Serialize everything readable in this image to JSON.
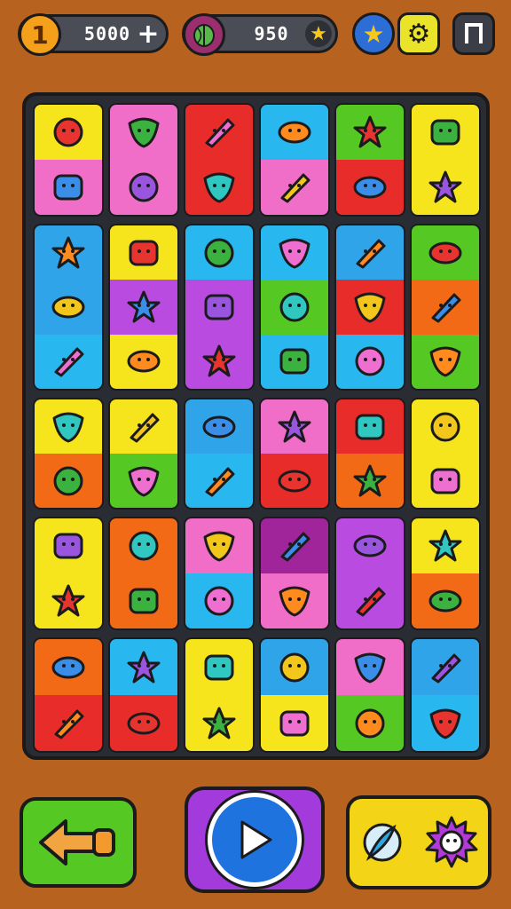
{
  "hud": {
    "coin_symbol": "1",
    "coins": "5000",
    "add_label": "+",
    "gems": "950",
    "star_badge": "★",
    "gear_glyph": "⚙"
  },
  "palette": {
    "yellow": "#f6e51c",
    "pink": "#f16ec8",
    "red": "#e82c2a",
    "cyan": "#29b7ef",
    "blue": "#2fa4e8",
    "green": "#55c824",
    "purple": "#b94be0",
    "orange": "#f26a15",
    "magenta": "#a0249a",
    "violet": "#8d5ae0"
  },
  "board": {
    "columns": [
      [
        {
          "colors": [
            "yellow",
            "pink"
          ],
          "icons": [
            "flashlight-icon",
            "leaf-icon"
          ]
        },
        {
          "colors": [
            "blue",
            "blue",
            "cyan"
          ],
          "icons": [
            "heart-icon",
            "virus-icon",
            "star-x-icon"
          ]
        },
        {
          "colors": [
            "yellow",
            "orange"
          ],
          "icons": [
            "bag-icon",
            "starfish-icon"
          ]
        },
        {
          "colors": [
            "yellow",
            "yellow"
          ],
          "icons": [
            "bat-icon",
            "bottle-icon"
          ]
        },
        {
          "colors": [
            "orange",
            "red"
          ],
          "icons": [
            "face-icon",
            "flashlight-icon"
          ]
        }
      ],
      [
        {
          "colors": [
            "pink",
            "pink"
          ],
          "icons": [
            "face-icon",
            "windmill-icon"
          ]
        },
        {
          "colors": [
            "yellow",
            "purple",
            "yellow"
          ],
          "icons": [
            "bread-icon",
            "ring-icon",
            "flower-icon"
          ]
        },
        {
          "colors": [
            "yellow",
            "green"
          ],
          "icons": [
            "rocket-icon",
            "bottle-icon"
          ]
        },
        {
          "colors": [
            "orange",
            "orange"
          ],
          "icons": [
            "bird-icon",
            "camera-icon"
          ]
        },
        {
          "colors": [
            "cyan",
            "red"
          ],
          "icons": [
            "bubble-icon",
            "palm-icon"
          ]
        }
      ],
      [
        {
          "colors": [
            "red",
            "red"
          ],
          "icons": [
            "cup-icon",
            "drink-icon"
          ]
        },
        {
          "colors": [
            "cyan",
            "purple",
            "purple"
          ],
          "icons": [
            "radio-icon",
            "bird-icon",
            "capsule-icon"
          ]
        },
        {
          "colors": [
            "blue",
            "cyan"
          ],
          "icons": [
            "calendar-icon",
            "domino-icon"
          ]
        },
        {
          "colors": [
            "pink",
            "cyan"
          ],
          "icons": [
            "grid-icon",
            "domino-icon"
          ]
        },
        {
          "colors": [
            "yellow",
            "yellow"
          ],
          "icons": [
            "suitcase-icon",
            "star-x-icon"
          ]
        }
      ],
      [
        {
          "colors": [
            "cyan",
            "pink"
          ],
          "icons": [
            "ring-icon",
            "hook-icon"
          ]
        },
        {
          "colors": [
            "cyan",
            "green",
            "cyan"
          ],
          "icons": [
            "donut-icon",
            "swirl-icon",
            "film-icon"
          ]
        },
        {
          "colors": [
            "pink",
            "red"
          ],
          "icons": [
            "radio-icon",
            "monster-icon"
          ]
        },
        {
          "colors": [
            "magenta",
            "pink"
          ],
          "icons": [
            "orange-icon",
            "lemon-icon"
          ]
        },
        {
          "colors": [
            "blue",
            "yellow"
          ],
          "icons": [
            "bat-icon",
            "ring-icon"
          ]
        }
      ],
      [
        {
          "colors": [
            "green",
            "red"
          ],
          "icons": [
            "domino-icon",
            "snake-icon"
          ]
        },
        {
          "colors": [
            "blue",
            "red",
            "cyan"
          ],
          "icons": [
            "monster-icon",
            "paper-icon",
            "trident-icon"
          ]
        },
        {
          "colors": [
            "red",
            "orange"
          ],
          "icons": [
            "suitcase-icon",
            "donut-icon"
          ]
        },
        {
          "colors": [
            "purple",
            "purple"
          ],
          "icons": [
            "kite-icon",
            "globe-icon"
          ]
        },
        {
          "colors": [
            "pink",
            "green"
          ],
          "icons": [
            "rocket-icon",
            "kite-icon"
          ]
        }
      ],
      [
        {
          "colors": [
            "yellow",
            "yellow"
          ],
          "icons": [
            "bubble-icon",
            "palm-icon"
          ]
        },
        {
          "colors": [
            "green",
            "orange",
            "green"
          ],
          "icons": [
            "leaf-blob-icon",
            "ball-icon",
            "pig-icon"
          ]
        },
        {
          "colors": [
            "yellow",
            "yellow"
          ],
          "icons": [
            "lamp-icon",
            "bird-icon"
          ]
        },
        {
          "colors": [
            "yellow",
            "orange"
          ],
          "icons": [
            "suitcase-icon",
            "virus-icon"
          ]
        },
        {
          "colors": [
            "blue",
            "cyan"
          ],
          "icons": [
            "bird-icon",
            "star-icon"
          ]
        }
      ]
    ]
  },
  "bottom": {
    "back_icon": "arrow-left-icon",
    "play_icon": "play-icon",
    "hint_icons": [
      "compass-icon",
      "sunburst-icon"
    ]
  }
}
